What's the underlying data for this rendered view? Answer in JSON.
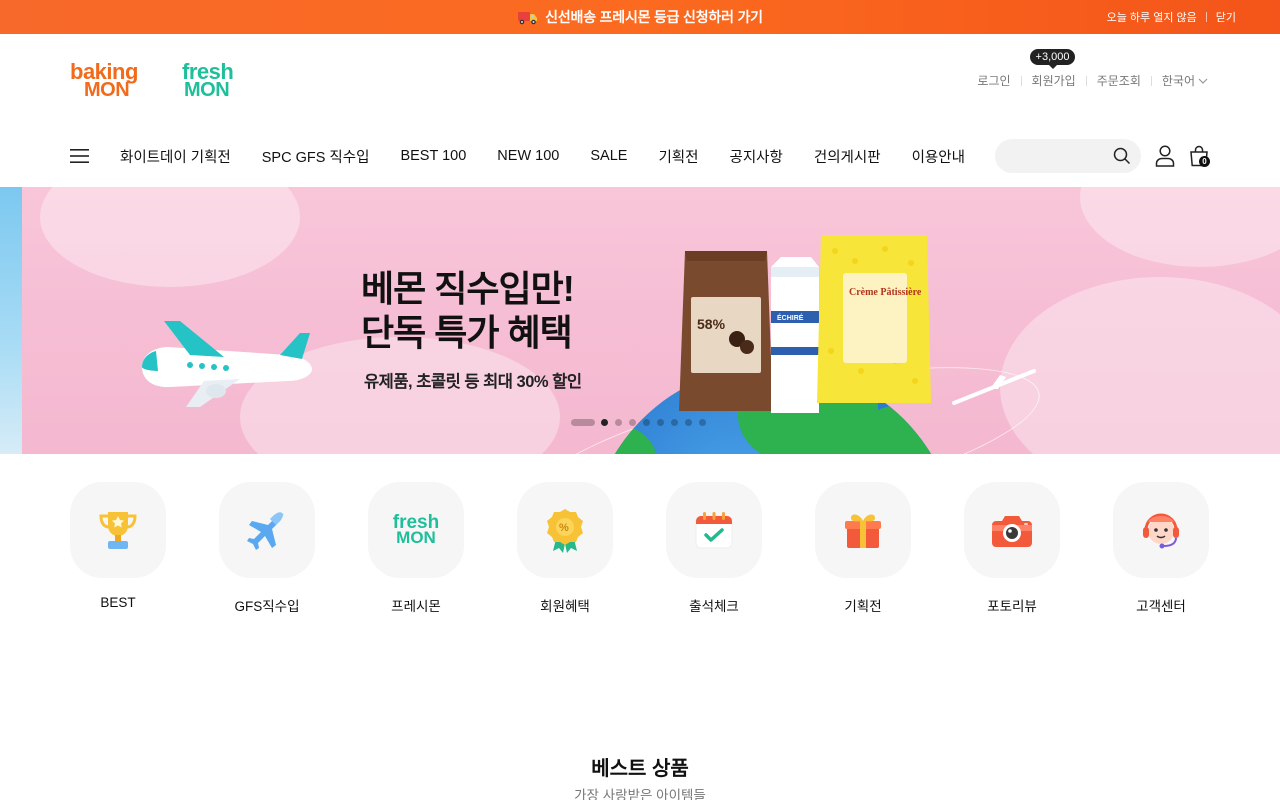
{
  "promo": {
    "text": "신선배송 프레시몬 등급 신청하러 가기",
    "icon": "truck-icon",
    "hide_today": "오늘 하루 열지 않음",
    "close": "닫기"
  },
  "logos": {
    "baking_line1": "baking",
    "baking_line2": "MON",
    "fresh_line1": "fresh",
    "fresh_line2": "MON"
  },
  "util": {
    "login": "로그인",
    "signup": "회원가입",
    "signup_badge": "+3,000",
    "order_lookup": "주문조회",
    "language": "한국어"
  },
  "nav": {
    "items": [
      "화이트데이 기획전",
      "SPC GFS 직수입",
      "BEST 100",
      "NEW 100",
      "SALE",
      "기획전",
      "공지사항",
      "건의게시판",
      "이용안내"
    ]
  },
  "header_icons": {
    "search_placeholder": "",
    "cart_count": "0"
  },
  "banner": {
    "headline_1": "베몬 직수입만!",
    "headline_2": "단독 특가 혜택",
    "sub": "유제품, 초콜릿 등 최대 30% 할인",
    "slide_count": 8,
    "active_slide": 1,
    "products": {
      "choc_label": "58%",
      "milk_label": "ÉCHIRÉ",
      "cream_label": "Crème Pâtissière"
    }
  },
  "categories": [
    {
      "label": "BEST",
      "icon": "trophy-icon"
    },
    {
      "label": "GFS직수입",
      "icon": "airplane-icon"
    },
    {
      "label": "프레시몬",
      "icon": "freshmon-logo-icon"
    },
    {
      "label": "회원혜택",
      "icon": "badge-icon"
    },
    {
      "label": "출석체크",
      "icon": "calendar-check-icon"
    },
    {
      "label": "기획전",
      "icon": "gift-icon"
    },
    {
      "label": "포토리뷰",
      "icon": "camera-icon"
    },
    {
      "label": "고객센터",
      "icon": "headset-icon"
    }
  ],
  "best": {
    "title": "베스트 상품",
    "subtitle": "가장 사랑받은 아이템들"
  },
  "colors": {
    "promo_bar": "#f7692a",
    "baking_brand": "#f26a1b",
    "fresh_brand": "#1fbf9c",
    "banner_bg": "#f6bfd5"
  }
}
